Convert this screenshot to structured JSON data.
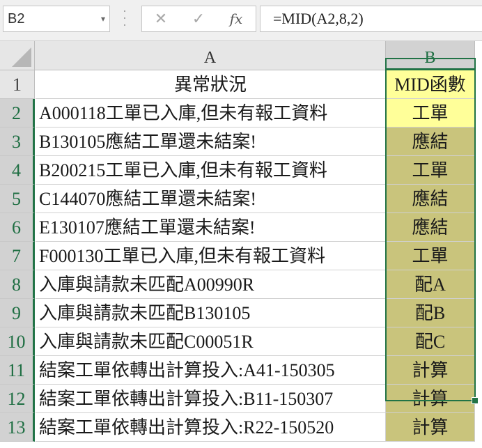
{
  "formula_bar": {
    "name_box": "B2",
    "cancel_icon": "✕",
    "enter_icon": "✓",
    "fx_label": "fx",
    "formula": "=MID(A2,8,2)"
  },
  "columns": [
    {
      "label": "A"
    },
    {
      "label": "B"
    }
  ],
  "rows": [
    {
      "num": "1",
      "a": "異常狀況",
      "b": "MID函數"
    },
    {
      "num": "2",
      "a": "A000118工單已入庫,但未有報工資料",
      "b": "工單"
    },
    {
      "num": "3",
      "a": "B130105應結工單還未結案!",
      "b": "應結"
    },
    {
      "num": "4",
      "a": "B200215工單已入庫,但未有報工資料",
      "b": "工單"
    },
    {
      "num": "5",
      "a": "C144070應結工單還未結案!",
      "b": "應結"
    },
    {
      "num": "6",
      "a": "E130107應結工單還未結案!",
      "b": "應結"
    },
    {
      "num": "7",
      "a": "F000130工單已入庫,但未有報工資料",
      "b": "工單"
    },
    {
      "num": "8",
      "a": "入庫與請款未匹配A00990R",
      "b": "配A"
    },
    {
      "num": "9",
      "a": "入庫與請款未匹配B130105",
      "b": "配B"
    },
    {
      "num": "10",
      "a": "入庫與請款未匹配C00051R",
      "b": "配C"
    },
    {
      "num": "11",
      "a": "結案工單依轉出計算投入:A41-150305",
      "b": "計算"
    },
    {
      "num": "12",
      "a": "結案工單依轉出計算投入:B11-150307",
      "b": "計算"
    },
    {
      "num": "13",
      "a": "結案工單依轉出計算投入:R22-150520",
      "b": "計算"
    }
  ],
  "colors": {
    "accent": "#217346",
    "highlight_yellow": "#ffff99",
    "olive_fill": "#c9c47c"
  }
}
